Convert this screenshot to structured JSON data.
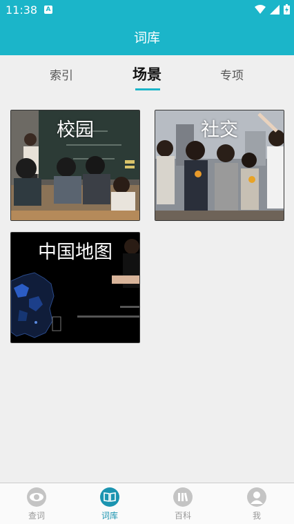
{
  "status": {
    "time": "11:38",
    "notification_badge": "A"
  },
  "header": {
    "title": "词库"
  },
  "tabs": [
    {
      "label": "索引",
      "active": false
    },
    {
      "label": "场景",
      "active": true
    },
    {
      "label": "专项",
      "active": false
    }
  ],
  "cards": [
    {
      "title": "校园",
      "image": "classroom-photo"
    },
    {
      "title": "社交",
      "image": "social-gathering-photo"
    },
    {
      "title": "中国地图",
      "image": "china-map-video-frame"
    }
  ],
  "bottom_nav": [
    {
      "label": "查词",
      "icon": "eye-icon",
      "active": false
    },
    {
      "label": "词库",
      "icon": "book-icon",
      "active": true
    },
    {
      "label": "百科",
      "icon": "books-icon",
      "active": false
    },
    {
      "label": "我",
      "icon": "person-icon",
      "active": false
    }
  ],
  "colors": {
    "accent": "#1bb5c9",
    "nav_active": "#1b94b0",
    "background": "#efefef"
  }
}
